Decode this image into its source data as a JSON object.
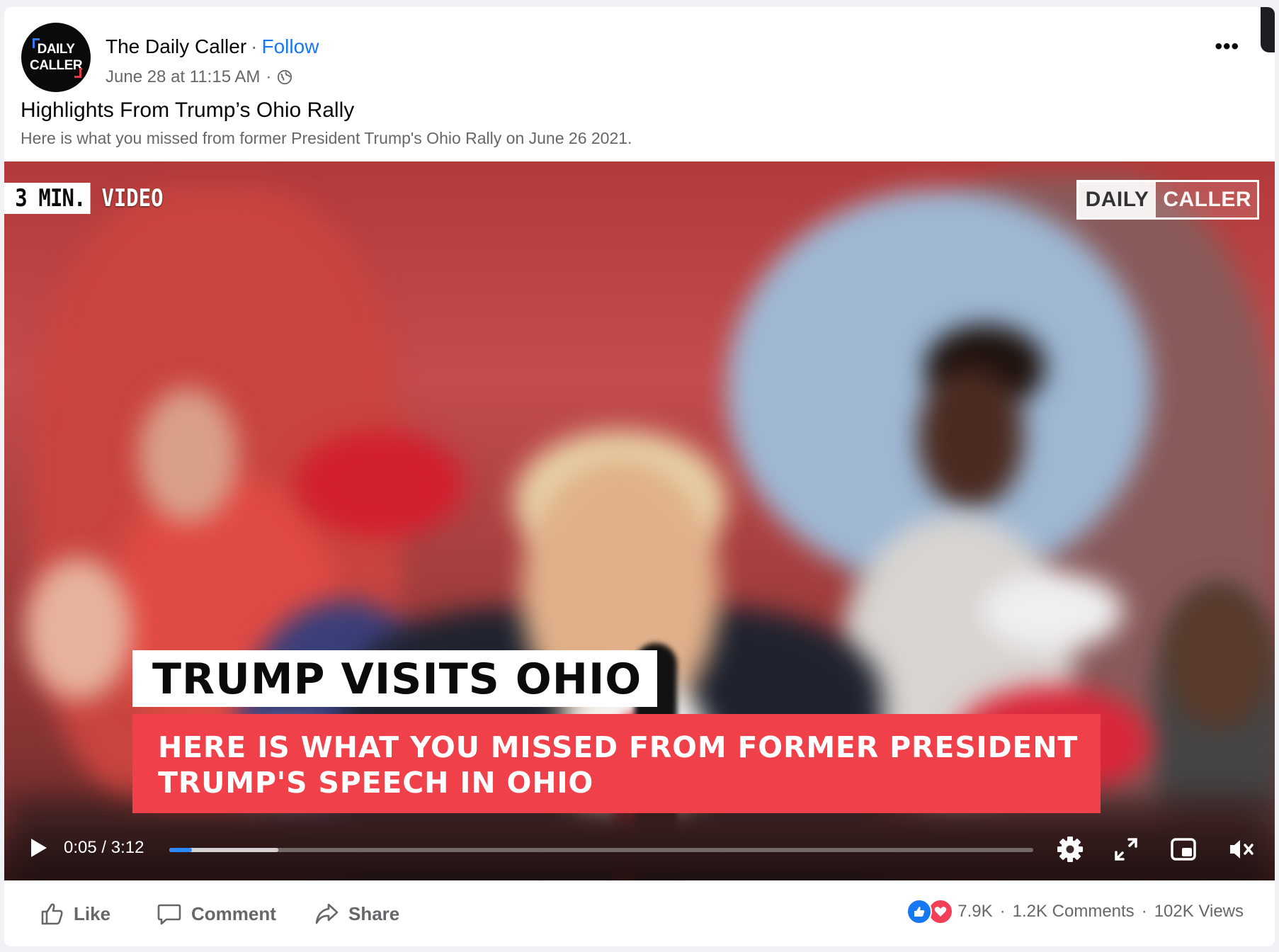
{
  "post": {
    "page_name": "The Daily Caller",
    "separator": "·",
    "follow_label": "Follow",
    "timestamp": "June 28 at 11:15 AM",
    "meta_separator": "·",
    "privacy_icon": "globe-icon",
    "more_icon": "more-options-icon",
    "avatar_text_top": "DAILY",
    "avatar_text_bottom": "CALLER",
    "title": "Highlights From Trump’s Ohio Rally",
    "description": "Here is what you missed from former President Trump's Ohio Rally on June 26 2021."
  },
  "video": {
    "tag_left": "3 MIN.",
    "tag_right": "VIDEO",
    "watermark_left": "DAILY",
    "watermark_right": "CALLER",
    "lower_third_title": "TRUMP VISITS OHIO",
    "lower_third_sub": "HERE IS WHAT YOU MISSED FROM FORMER PRESIDENT TRUMP'S SPEECH IN OHIO",
    "time_current": "0:05",
    "time_separator": "/",
    "time_total": "3:12",
    "progress_played_fraction": 0.026,
    "progress_buffered_fraction": 0.126,
    "controls": [
      "play-icon",
      "settings-icon",
      "fullscreen-icon",
      "picture-in-picture-icon",
      "volume-muted-icon"
    ]
  },
  "actions": {
    "like_label": "Like",
    "comment_label": "Comment",
    "share_label": "Share"
  },
  "stats": {
    "reactions_count": "7.9K",
    "comments": "1.2K Comments",
    "separator": "·",
    "views": "102K Views"
  },
  "colors": {
    "accent": "#1877f2",
    "text_primary": "#050505",
    "text_secondary": "#65676b",
    "lower_third_red": "#f0414b",
    "progress_blue": "#2d88ff",
    "love_red": "#f33e58"
  }
}
